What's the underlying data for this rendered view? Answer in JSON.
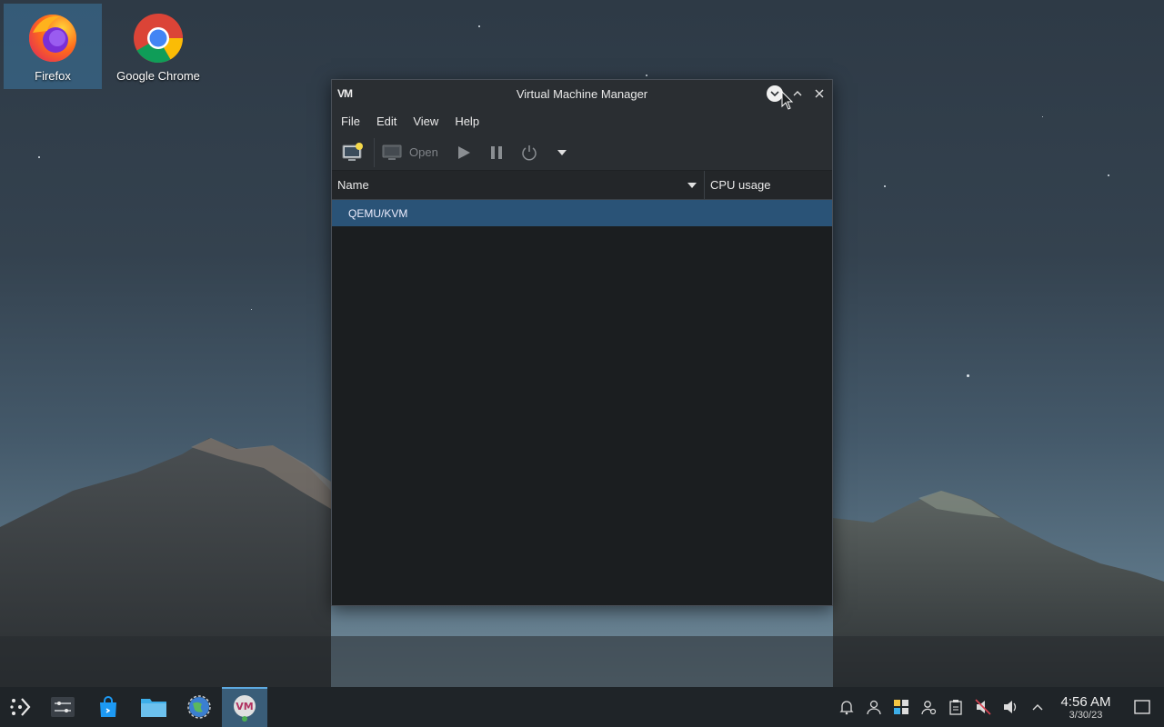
{
  "desktop": {
    "icons": [
      {
        "label": "Firefox"
      },
      {
        "label": "Google Chrome"
      }
    ]
  },
  "window": {
    "app_icon": "VM",
    "title": "Virtual Machine Manager",
    "menu": [
      "File",
      "Edit",
      "View",
      "Help"
    ],
    "toolbar": {
      "open_label": "Open"
    },
    "columns": {
      "name": "Name",
      "cpu": "CPU usage"
    },
    "rows": [
      {
        "name": "QEMU/KVM"
      }
    ]
  },
  "taskbar": {
    "active_app_icon": "VM",
    "clock": {
      "time": "4:56 AM",
      "date": "3/30/23"
    }
  }
}
